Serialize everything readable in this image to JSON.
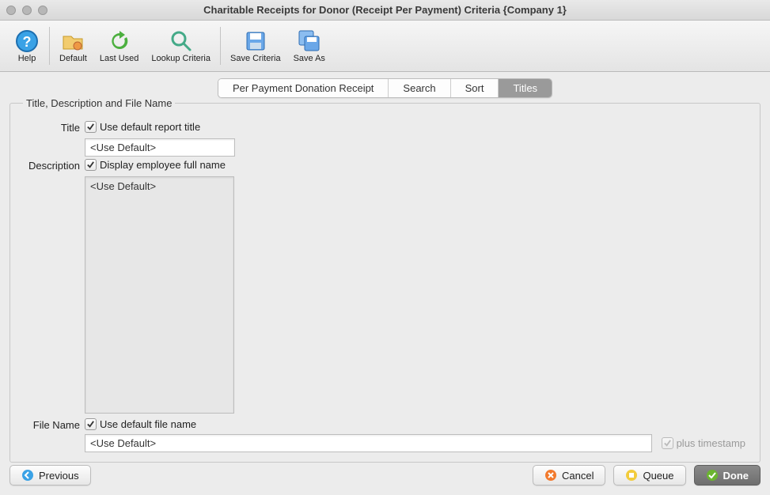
{
  "window": {
    "title": "Charitable Receipts for Donor (Receipt Per Payment) Criteria {Company 1}"
  },
  "toolbar": {
    "help": "Help",
    "default": "Default",
    "last_used": "Last Used",
    "lookup": "Lookup Criteria",
    "save": "Save Criteria",
    "save_as": "Save As"
  },
  "tabs": {
    "per_payment": "Per Payment Donation Receipt",
    "search": "Search",
    "sort": "Sort",
    "titles": "Titles"
  },
  "section": {
    "legend": "Title, Description and File Name",
    "title_label": "Title",
    "title_cb": "Use default report title",
    "title_value": "<Use Default>",
    "desc_label": "Description",
    "desc_cb": "Display employee full name",
    "desc_value": "<Use Default>",
    "file_label": "File Name",
    "file_cb": "Use default file name",
    "file_value": "<Use Default>",
    "plus_ts": "plus timestamp"
  },
  "footer": {
    "previous": "Previous",
    "cancel": "Cancel",
    "queue": "Queue",
    "done": "Done"
  }
}
